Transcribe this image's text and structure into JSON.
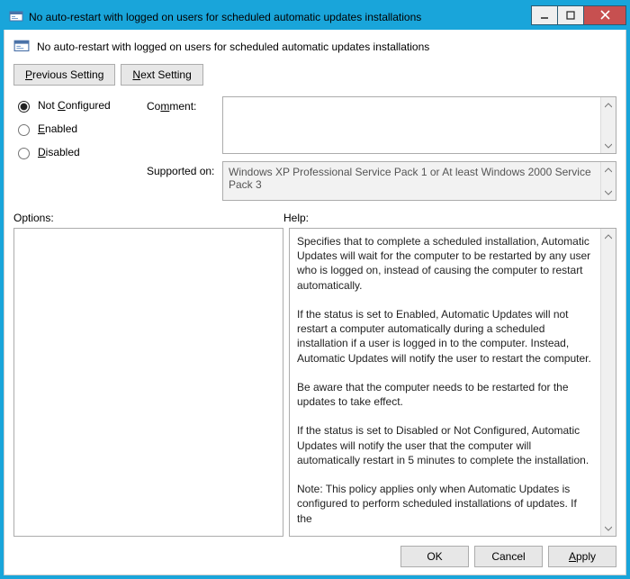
{
  "window": {
    "title": "No auto-restart with logged on users for scheduled automatic updates installations"
  },
  "header": {
    "title": "No auto-restart with logged on users for scheduled automatic updates installations"
  },
  "nav": {
    "previous_pre": "P",
    "previous_post": "revious Setting",
    "next_pre": "N",
    "next_post": "ext Setting"
  },
  "state": {
    "selected": "not_configured",
    "not_cfg_pre": "Not ",
    "not_cfg_u": "C",
    "not_cfg_post": "onfigured",
    "enabled_u": "E",
    "enabled_post": "nabled",
    "disabled_u": "D",
    "disabled_post": "isabled"
  },
  "labels": {
    "comment_pre": "Co",
    "comment_u": "m",
    "comment_post": "ment:",
    "supported": "Supported on:",
    "options": "Options:",
    "help": "Help:"
  },
  "supported_on": "Windows XP Professional Service Pack 1 or At least Windows 2000 Service Pack 3",
  "comment": "",
  "options_body": "",
  "help_body": "Specifies that to complete a scheduled installation, Automatic Updates will wait for the computer to be restarted by any user who is logged on, instead of causing the computer to restart automatically.\n\nIf the status is set to Enabled, Automatic Updates will not restart a computer automatically during a scheduled installation if a user is logged in to the computer. Instead, Automatic Updates will notify the user to restart the computer.\n\nBe aware that the computer needs to be restarted for the updates to take effect.\n\nIf the status is set to Disabled or Not Configured, Automatic Updates will notify the user that the computer will automatically restart in 5 minutes to complete the installation.\n\nNote: This policy applies only when Automatic Updates is configured to perform scheduled installations of updates. If the",
  "footer": {
    "ok": "OK",
    "cancel": "Cancel",
    "apply_u": "A",
    "apply_post": "pply"
  }
}
